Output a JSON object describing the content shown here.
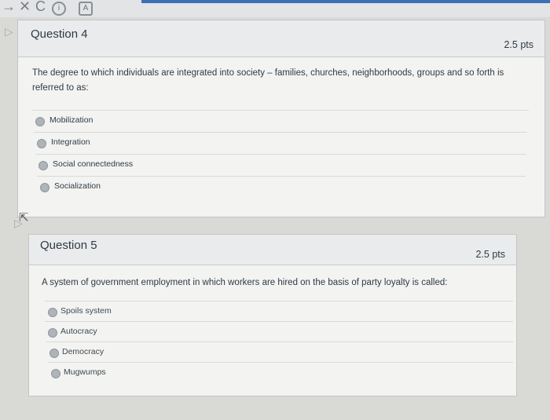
{
  "toolbar": {
    "back_glyph": "→",
    "close_glyph": "✕",
    "reload_glyph": "C",
    "info_glyph": "i",
    "tab_glyph": "A"
  },
  "questions": [
    {
      "title": "Question 4",
      "points": "2.5 pts",
      "text": "The degree to which individuals are integrated into society – families, churches, neighborhoods, groups and so forth is referred to as:",
      "answers": [
        "Mobilization",
        "Integration",
        "Social connectedness",
        "Socialization"
      ]
    },
    {
      "title": "Question 5",
      "points": "2.5 pts",
      "text": "A system of government employment in which workers are hired on the basis of party loyalty is called:",
      "answers": [
        "Spoils system",
        "Autocracy",
        "Democracy",
        "Mugwumps"
      ]
    }
  ]
}
